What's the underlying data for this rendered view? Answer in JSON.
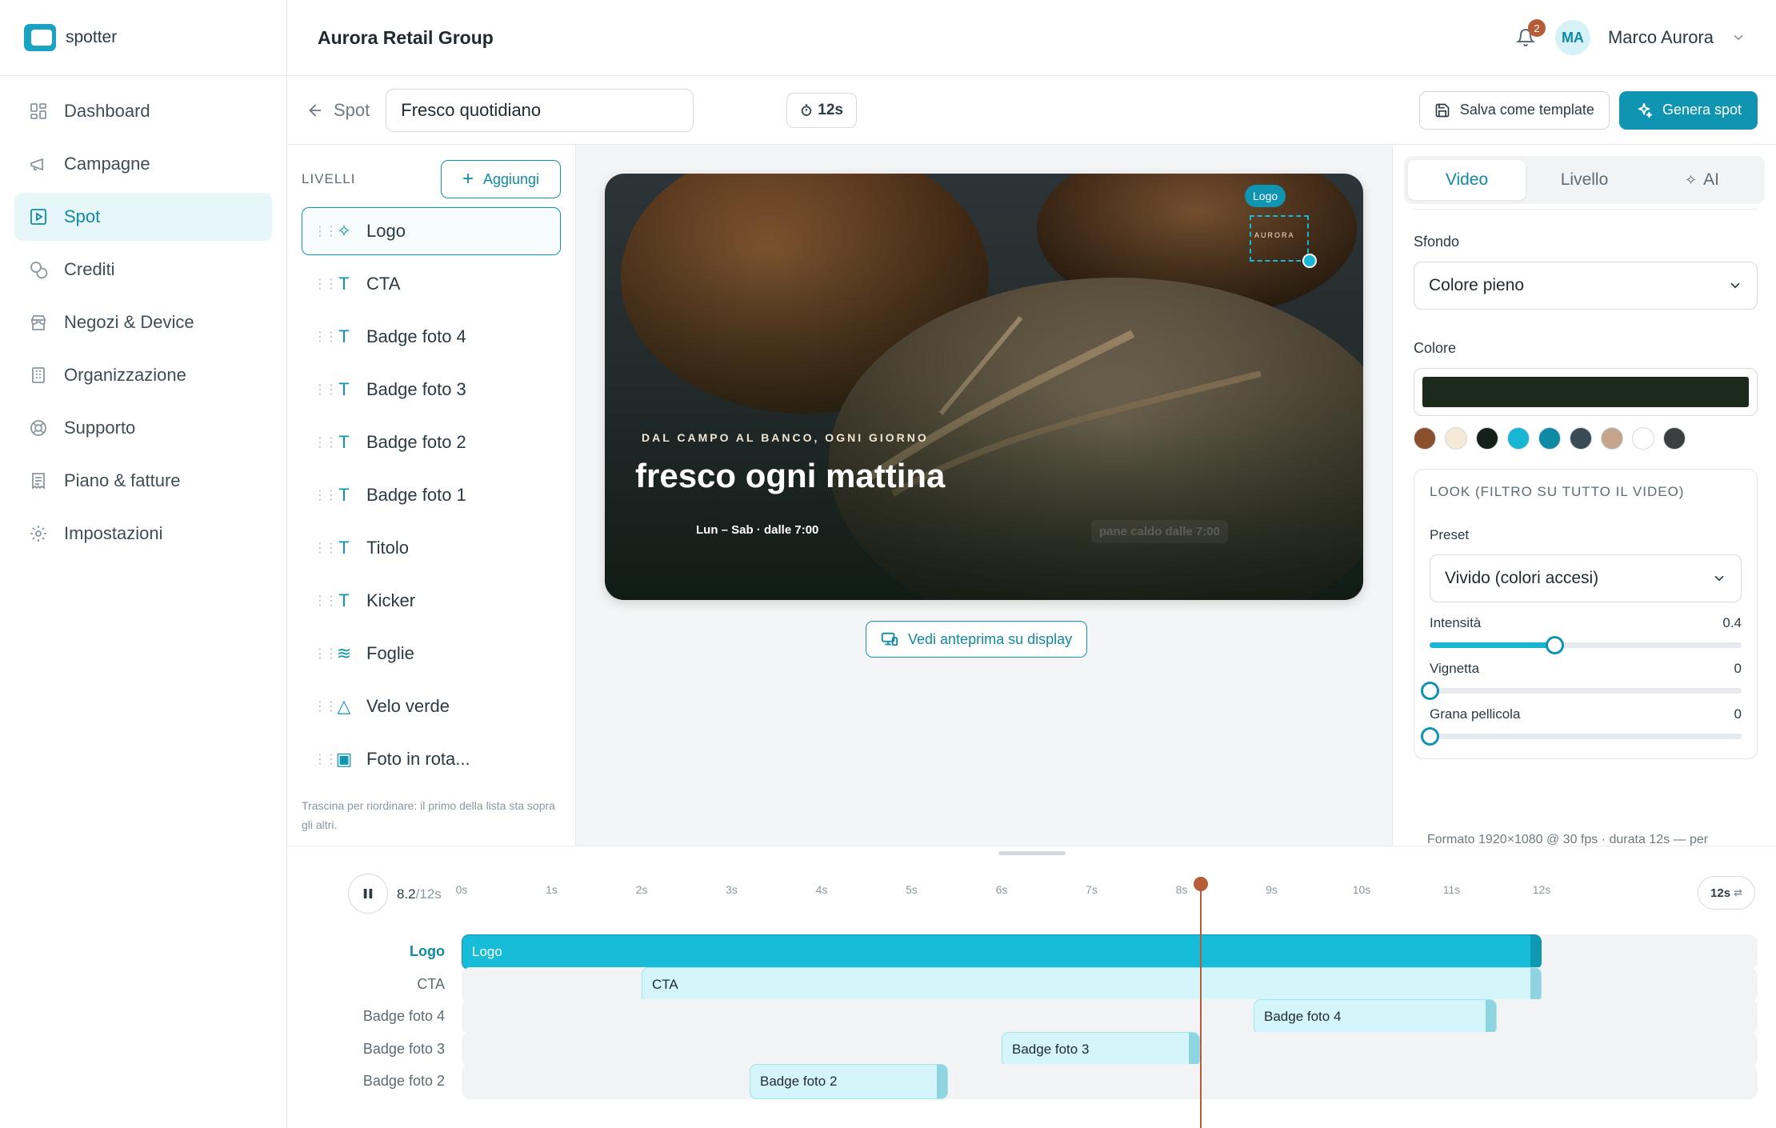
{
  "brand": {
    "name": "spotter"
  },
  "nav": [
    {
      "label": "Dashboard",
      "icon": "dashboard-icon"
    },
    {
      "label": "Campagne",
      "icon": "megaphone-icon"
    },
    {
      "label": "Spot",
      "icon": "play-square-icon",
      "active": true
    },
    {
      "label": "Crediti",
      "icon": "coins-icon"
    },
    {
      "label": "Negozi & Device",
      "icon": "store-icon"
    },
    {
      "label": "Organizzazione",
      "icon": "building-icon"
    },
    {
      "label": "Supporto",
      "icon": "lifebuoy-icon"
    },
    {
      "label": "Piano & fatture",
      "icon": "receipt-icon"
    },
    {
      "label": "Impostazioni",
      "icon": "gear-icon"
    }
  ],
  "header": {
    "org_name": "Aurora Retail Group",
    "notifications": "2",
    "avatar_initials": "MA",
    "user_name": "Marco Aurora"
  },
  "toolbar": {
    "back_label": "Spot",
    "spot_title": "Fresco quotidiano",
    "duration": "12s",
    "save_template_label": "Salva come template",
    "generate_label": "Genera spot"
  },
  "layers": {
    "title": "LIVELLI",
    "add_label": "Aggiungi",
    "items": [
      {
        "label": "Logo",
        "icon": "sparkle-icon",
        "glyph": "✧"
      },
      {
        "label": "CTA",
        "icon": "text-icon",
        "glyph": "T"
      },
      {
        "label": "Badge foto 4",
        "icon": "text-icon",
        "glyph": "T"
      },
      {
        "label": "Badge foto 3",
        "icon": "text-icon",
        "glyph": "T"
      },
      {
        "label": "Badge foto 2",
        "icon": "text-icon",
        "glyph": "T"
      },
      {
        "label": "Badge foto 1",
        "icon": "text-icon",
        "glyph": "T"
      },
      {
        "label": "Titolo",
        "icon": "text-icon",
        "glyph": "T"
      },
      {
        "label": "Kicker",
        "icon": "text-icon",
        "glyph": "T"
      },
      {
        "label": "Foglie",
        "icon": "wind-icon",
        "glyph": "≋"
      },
      {
        "label": "Velo verde",
        "icon": "shapes-icon",
        "glyph": "△"
      },
      {
        "label": "Foto in rota...",
        "icon": "image-icon",
        "glyph": "▣"
      }
    ],
    "hint": "Trascina per riordinare: il primo della lista sta sopra gli altri."
  },
  "preview": {
    "logo_tag": "Logo",
    "logo_mark": "AURORA",
    "kicker": "DAL CAMPO AL BANCO, OGNI GIORNO",
    "title": "fresco ogni mattina",
    "cta": "Lun – Sab · dalle 7:00",
    "ghost_badge": "pane caldo dalle 7:00",
    "display_button": "Vedi anteprima su display"
  },
  "props": {
    "tabs": [
      {
        "label": "Video",
        "active": true
      },
      {
        "label": "Livello"
      },
      {
        "label": "AI",
        "icon": "sparkle-icon"
      }
    ],
    "background_label": "Sfondo",
    "background_value": "Colore pieno",
    "color_label": "Colore",
    "color_value": "#1c2a1c",
    "swatches": [
      "#8a4f2c",
      "#f5e8d6",
      "#15201a",
      "#17b6d4",
      "#0f8aa5",
      "#3b4b55",
      "#c4a48b",
      "#ffffff",
      "#3b3f3f"
    ],
    "look_title": "LOOK (FILTRO SU TUTTO IL VIDEO)",
    "preset_label": "Preset",
    "preset_value": "Vivido (colori accesi)",
    "sliders": [
      {
        "label": "Intensità",
        "value": "0.4",
        "fraction": 0.4
      },
      {
        "label": "Vignetta",
        "value": "0",
        "fraction": 0
      },
      {
        "label": "Grana pellicola",
        "value": "0",
        "fraction": 0
      }
    ],
    "format_note": "Formato 1920×1080 @ 30 fps · durata 12s — per"
  },
  "timeline": {
    "current": "8.2",
    "total": "/12s",
    "duration_chip": "12s",
    "ticks": [
      "0s",
      "1s",
      "2s",
      "3s",
      "4s",
      "5s",
      "6s",
      "7s",
      "8s",
      "9s",
      "10s",
      "11s",
      "12s"
    ],
    "playhead_seconds": 8.2,
    "total_seconds": 12,
    "tracks": [
      {
        "label": "Logo",
        "clip": "Logo",
        "start": 0,
        "end": 12,
        "active": true
      },
      {
        "label": "CTA",
        "clip": "CTA",
        "start": 2,
        "end": 12
      },
      {
        "label": "Badge foto 4",
        "clip": "Badge foto 4",
        "start": 8.8,
        "end": 11.5
      },
      {
        "label": "Badge foto 3",
        "clip": "Badge foto 3",
        "start": 6,
        "end": 8.2
      },
      {
        "label": "Badge foto 2",
        "clip": "Badge foto 2",
        "start": 3.2,
        "end": 5.4
      }
    ]
  }
}
